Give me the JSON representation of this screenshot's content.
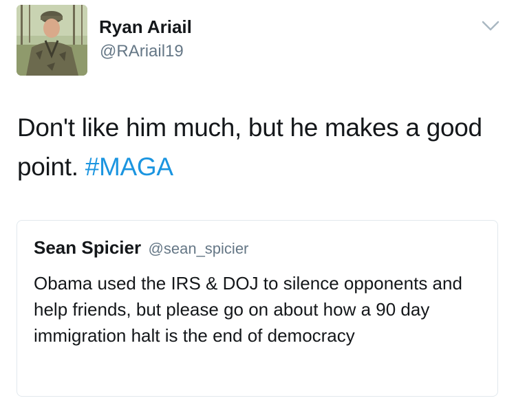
{
  "tweet": {
    "author": {
      "name": "Ryan Ariail",
      "handle": "@RAriail19"
    },
    "text_before_hashtag": "Don't like him much, but he makes a good point.",
    "hashtag": "#MAGA",
    "menu_icon": "chevron-down-icon"
  },
  "quoted_tweet": {
    "author": {
      "name": "Sean Spicier",
      "handle": "@sean_spicier"
    },
    "text": "Obama used the IRS & DOJ to silence opponents and help friends, but please go on about how a 90 day immigration halt is the end of democracy"
  },
  "colors": {
    "hashtag": "#1b95e0",
    "handle": "#657786",
    "text": "#14171a",
    "border": "#e1e8ed"
  }
}
